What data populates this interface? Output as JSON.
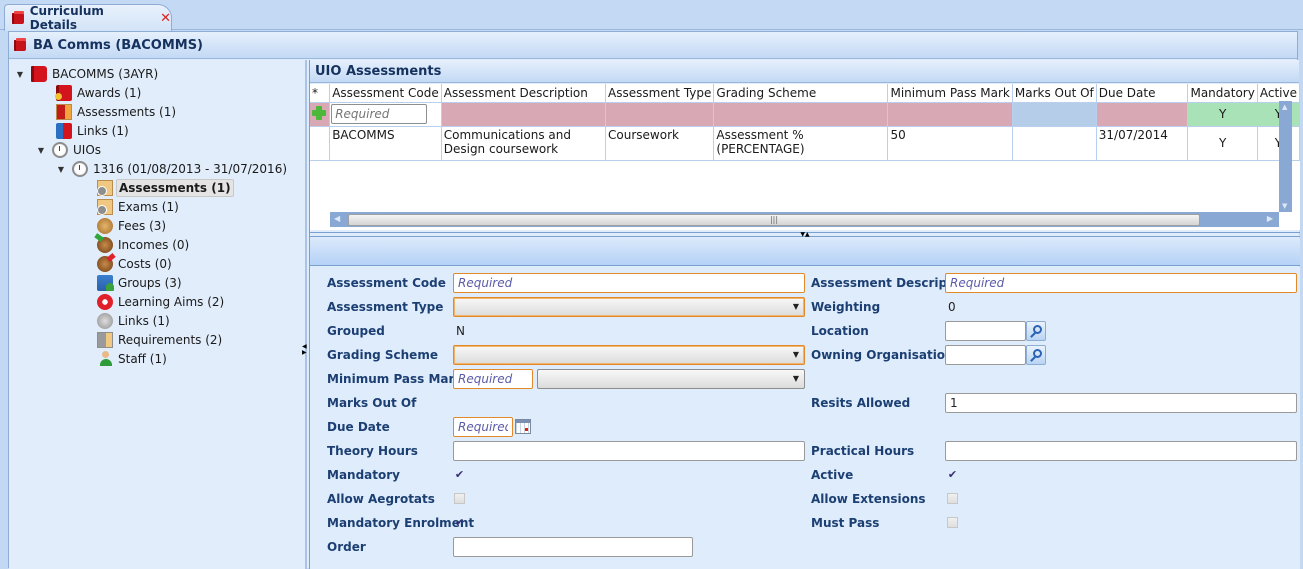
{
  "tab": {
    "label": "Curriculum Details",
    "close_icon": "close-icon"
  },
  "panel_title": "BA Comms (BACOMMS)",
  "tree": {
    "root": "BACOMMS (3AYR)",
    "items": [
      {
        "label": "Awards (1)",
        "icon": "award-icon"
      },
      {
        "label": "Assessments (1)",
        "icon": "assessments-icon"
      },
      {
        "label": "Links (1)",
        "icon": "links-icon"
      },
      {
        "label": "UIOs",
        "icon": "clock-icon"
      },
      {
        "label": "1316 (01/08/2013 - 31/07/2016)",
        "icon": "clock-icon"
      },
      {
        "label": "Assessments (1)",
        "icon": "assessments-icon",
        "selected": true
      },
      {
        "label": "Exams (1)",
        "icon": "exams-icon"
      },
      {
        "label": "Fees (3)",
        "icon": "fees-icon"
      },
      {
        "label": "Incomes (0)",
        "icon": "incomes-icon"
      },
      {
        "label": "Costs (0)",
        "icon": "costs-icon"
      },
      {
        "label": "Groups (3)",
        "icon": "groups-icon"
      },
      {
        "label": "Learning Aims (2)",
        "icon": "learning-aims-icon"
      },
      {
        "label": "Links (1)",
        "icon": "links-icon"
      },
      {
        "label": "Requirements (2)",
        "icon": "requirements-icon"
      },
      {
        "label": "Staff (1)",
        "icon": "staff-icon"
      }
    ]
  },
  "grid": {
    "title": "UIO Assessments",
    "columns": [
      "*",
      "Assessment Code",
      "Assessment Description",
      "Assessment Type",
      "Grading Scheme",
      "Minimum Pass Mark",
      "Marks Out Of",
      "Due Date",
      "Mandatory",
      "Active"
    ],
    "new_row": {
      "code_placeholder": "Required",
      "mandatory": "Y",
      "active": "Y"
    },
    "rows": [
      {
        "code": "BACOMMS",
        "description": "Communications and Design coursework",
        "type": "Coursework",
        "grading_scheme": "Assessment % (PERCENTAGE)",
        "min_pass_mark": "50",
        "marks_out_of": "",
        "due_date": "31/07/2014",
        "mandatory": "Y",
        "active": "Y"
      }
    ],
    "hscroll_grip": "|||"
  },
  "form": {
    "assessment_code": {
      "label": "Assessment Code",
      "placeholder": "Required",
      "value": ""
    },
    "assessment_description": {
      "label": "Assessment Description",
      "placeholder": "Required",
      "value": ""
    },
    "assessment_type": {
      "label": "Assessment Type",
      "value": ""
    },
    "weighting": {
      "label": "Weighting",
      "value": "0"
    },
    "grouped": {
      "label": "Grouped",
      "value": "N"
    },
    "location": {
      "label": "Location",
      "value": ""
    },
    "grading_scheme": {
      "label": "Grading Scheme",
      "value": ""
    },
    "owning_organisation": {
      "label": "Owning Organisation",
      "value": ""
    },
    "minimum_pass_mark": {
      "label": "Minimum Pass Mark",
      "placeholder": "Required",
      "value": ""
    },
    "marks_out_of": {
      "label": "Marks Out Of"
    },
    "resits_allowed": {
      "label": "Resits Allowed",
      "value": "1"
    },
    "due_date": {
      "label": "Due Date",
      "placeholder": "Required",
      "value": ""
    },
    "theory_hours": {
      "label": "Theory Hours",
      "value": ""
    },
    "practical_hours": {
      "label": "Practical Hours",
      "value": ""
    },
    "mandatory": {
      "label": "Mandatory",
      "checked": true
    },
    "active": {
      "label": "Active",
      "checked": true
    },
    "allow_aegrotats": {
      "label": "Allow Aegrotats",
      "checked": false
    },
    "allow_extensions": {
      "label": "Allow Extensions",
      "checked": false
    },
    "mandatory_enrolment": {
      "label": "Mandatory Enrolment",
      "checked": true
    },
    "must_pass": {
      "label": "Must Pass",
      "checked": false
    },
    "order": {
      "label": "Order",
      "value": ""
    }
  },
  "glyphs": {
    "expanded": "▼",
    "dropdown": "▼",
    "check": "✔",
    "up": "▲",
    "down": "▼",
    "left": "◀",
    "right": "▶"
  }
}
